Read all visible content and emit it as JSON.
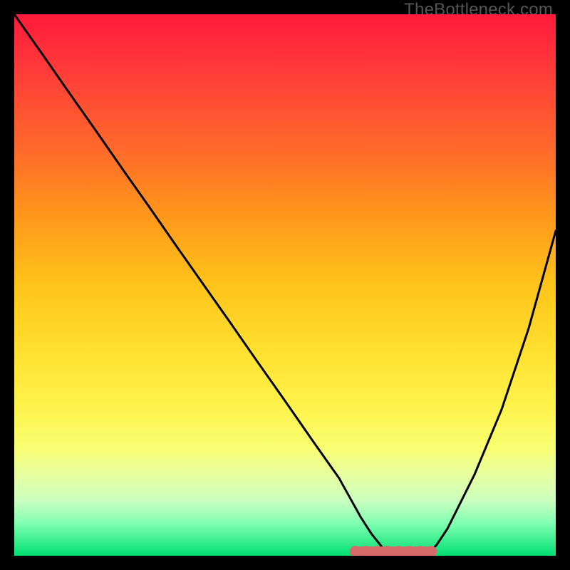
{
  "watermark": "TheBottleneck.com",
  "colors": {
    "background": "#000000",
    "curve_stroke": "#000000",
    "marker_fill": "#d96a6a",
    "marker_stroke": "#d96a6a"
  },
  "chart_data": {
    "type": "line",
    "title": "",
    "xlabel": "",
    "ylabel": "",
    "xlim": [
      0,
      100
    ],
    "ylim": [
      0,
      100
    ],
    "series": [
      {
        "name": "bottleneck-curve",
        "x": [
          0,
          5,
          10,
          15,
          20,
          25,
          30,
          35,
          40,
          45,
          50,
          55,
          60,
          62,
          64,
          66,
          68,
          70,
          72,
          74,
          76,
          78,
          80,
          85,
          90,
          95,
          100
        ],
        "y": [
          100,
          92.9,
          85.7,
          78.6,
          71.4,
          64.3,
          57.1,
          50.0,
          42.9,
          35.7,
          28.6,
          21.4,
          14.3,
          10.7,
          7.1,
          4.0,
          1.5,
          0.0,
          0.0,
          0.0,
          0.0,
          2.0,
          5.0,
          15.0,
          27.0,
          42.0,
          60.0
        ]
      }
    ],
    "markers": [
      {
        "name": "optimal-range-point",
        "x": 63,
        "y": 0
      },
      {
        "name": "optimal-range-point",
        "x": 65,
        "y": 0
      },
      {
        "name": "optimal-range-point",
        "x": 67,
        "y": 0
      },
      {
        "name": "optimal-range-point",
        "x": 69,
        "y": 0
      },
      {
        "name": "optimal-range-point",
        "x": 71,
        "y": 0
      },
      {
        "name": "optimal-range-point",
        "x": 73,
        "y": 0
      },
      {
        "name": "optimal-range-point",
        "x": 75,
        "y": 0
      },
      {
        "name": "optimal-range-point",
        "x": 77,
        "y": 0
      }
    ]
  }
}
